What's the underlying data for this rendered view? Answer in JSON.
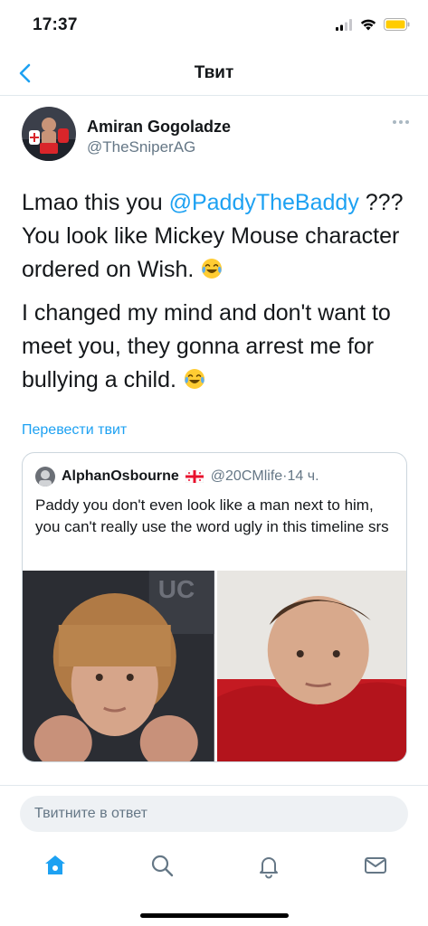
{
  "status_bar": {
    "time": "17:37",
    "icons": [
      "cellular-signal-icon",
      "wifi-icon",
      "battery-icon"
    ],
    "battery_color": "#ffcc00"
  },
  "nav": {
    "title": "Твит",
    "back_icon": "chevron-left-icon"
  },
  "tweet": {
    "author_name": "Amiran Gogoladze",
    "author_handle": "@TheSniperAG",
    "paragraph1_before": "Lmao this you ",
    "mention": "@PaddyTheBaddy",
    "paragraph1_after": " ??? You look like Mickey Mouse character ordered on Wish. ",
    "paragraph2": "I changed my mind and don't want to meet you, they gonna arrest me for bullying a child. ",
    "emoji": "face-with-tears-of-joy",
    "translate": "Перевести твит"
  },
  "quote": {
    "author_name": "AlphanOsbourne",
    "flag": "georgia-flag",
    "author_handle": "@20CMlife",
    "separator": " · ",
    "time": "14 ч.",
    "text": "Paddy you don't even look like a man next to him, you can't really use the word ugly in this timeline srs",
    "media_count": 2
  },
  "reply": {
    "placeholder": "Твитните в ответ"
  },
  "tabs": [
    "home-icon",
    "search-icon",
    "notifications-bell-icon",
    "messages-envelope-icon"
  ],
  "colors": {
    "accent": "#1da1f2",
    "text": "#14171a",
    "secondary": "#657786",
    "border": "#e1e8ed"
  }
}
